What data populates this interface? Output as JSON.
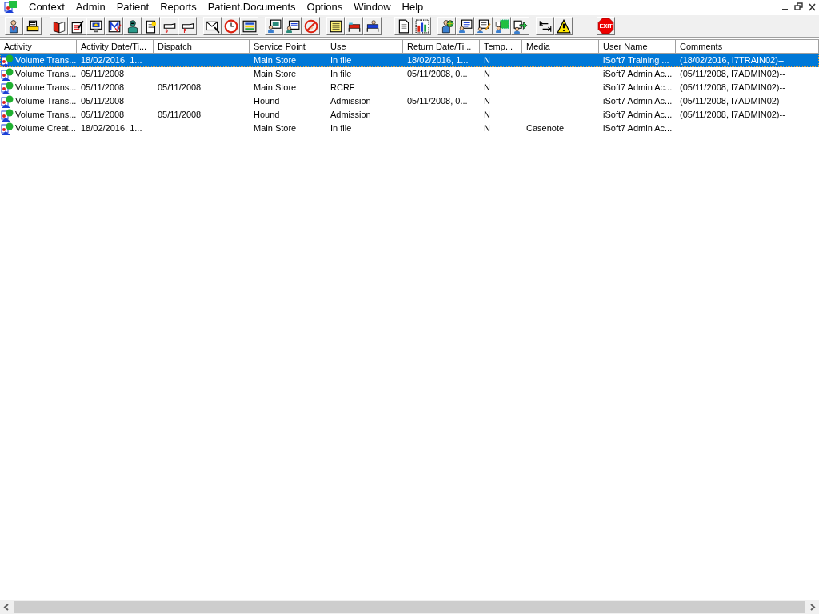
{
  "menu": [
    "Context",
    "Admin",
    "Patient",
    "Reports",
    "Patient.Documents",
    "Options",
    "Window",
    "Help"
  ],
  "toolbar": {
    "exit_label": "EXIT"
  },
  "table": {
    "columns": [
      "Activity",
      "Activity Date/Ti...",
      "Dispatch",
      "Service Point",
      "Use",
      "Return Date/Ti...",
      "Temp...",
      "Media",
      "User Name",
      "Comments"
    ],
    "rows": [
      {
        "selected": true,
        "cells": [
          "Volume Trans...",
          "18/02/2016, 1...",
          "",
          "Main Store",
          "In file",
          "18/02/2016, 1...",
          "N",
          "",
          "iSoft7 Training ...",
          "(18/02/2016, I7TRAIN02)--"
        ]
      },
      {
        "selected": false,
        "cells": [
          "Volume Trans...",
          "05/11/2008",
          "",
          "Main Store",
          "In file",
          "05/11/2008, 0...",
          "N",
          "",
          "iSoft7 Admin Ac...",
          "(05/11/2008, I7ADMIN02)--"
        ]
      },
      {
        "selected": false,
        "cells": [
          "Volume Trans...",
          "05/11/2008",
          "05/11/2008",
          "Main Store",
          "RCRF",
          "",
          "N",
          "",
          "iSoft7 Admin Ac...",
          "(05/11/2008, I7ADMIN02)--"
        ]
      },
      {
        "selected": false,
        "cells": [
          "Volume Trans...",
          "05/11/2008",
          "",
          "Hound",
          "Admission",
          "05/11/2008, 0...",
          "N",
          "",
          "iSoft7 Admin Ac...",
          "(05/11/2008, I7ADMIN02)--"
        ]
      },
      {
        "selected": false,
        "cells": [
          "Volume Trans...",
          "05/11/2008",
          "05/11/2008",
          "Hound",
          "Admission",
          "",
          "N",
          "",
          "iSoft7 Admin Ac...",
          "(05/11/2008, I7ADMIN02)--"
        ]
      },
      {
        "selected": false,
        "cells": [
          "Volume Creat...",
          "18/02/2016, 1...",
          "",
          "Main Store",
          "In file",
          "",
          "N",
          "Casenote",
          "iSoft7 Admin Ac...",
          ""
        ]
      }
    ]
  }
}
